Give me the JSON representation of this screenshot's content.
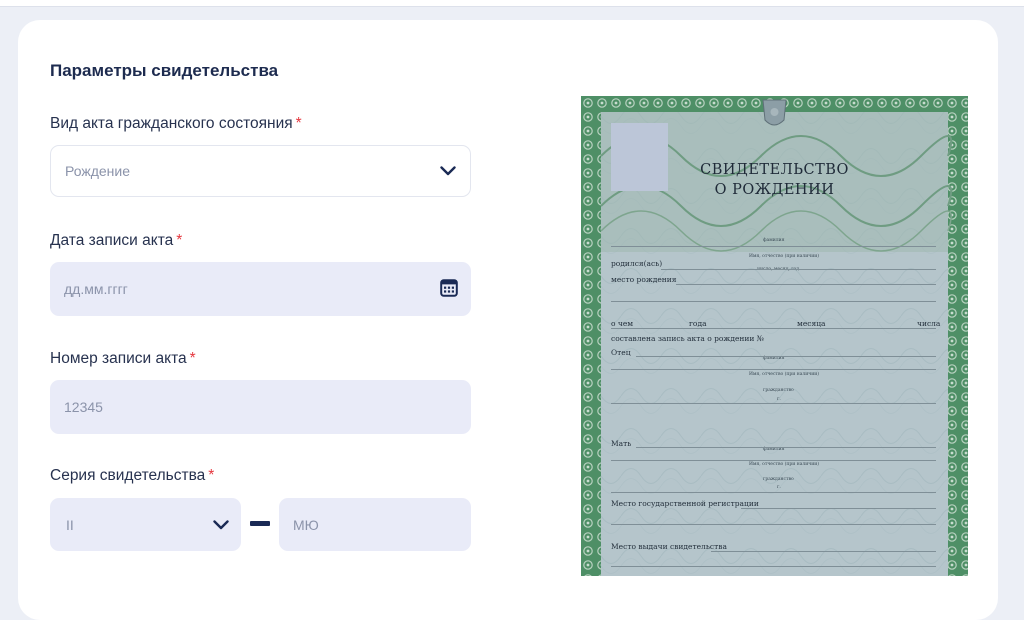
{
  "form": {
    "section_title": "Параметры свидетельства",
    "act_type": {
      "label": "Вид акта гражданского состояния",
      "required_mark": "*",
      "value": "Рождение"
    },
    "act_date": {
      "label": "Дата записи акта",
      "required_mark": "*",
      "placeholder": "дд.мм.гггг"
    },
    "act_number": {
      "label": "Номер записи акта",
      "required_mark": "*",
      "placeholder": "12345"
    },
    "cert_series": {
      "label": "Серия свидетельства",
      "required_mark": "*",
      "roman_value": "II",
      "letters_placeholder": "МЮ"
    }
  },
  "certificate": {
    "title_line1": "СВИДЕТЕЛЬСТВО",
    "title_line2": "О РОЖДЕНИИ",
    "field_born": "родился(ась)",
    "field_birthplace": "место рождения",
    "field_about": "о чем",
    "field_year": "года",
    "field_month": "месяца",
    "field_day": "числа",
    "field_record": "составлена запись акта о рождении №",
    "field_father": "Отец",
    "field_mother": "Мать",
    "field_reg_place": "Место государственной регистрации",
    "field_issue_place": "Место выдачи свидетельства",
    "hint_surname": "фамилия",
    "hint_name": "Имя, отчество (при наличии)",
    "hint_date": "число, месяц, год",
    "hint_citizenship": "гражданство",
    "hint_g": "г."
  },
  "icons": {
    "chevron": "chevron-down-icon",
    "calendar": "calendar-icon",
    "emblem": "emblem-icon"
  },
  "colors": {
    "accent": "#1a2a55",
    "required": "#e5363d",
    "field_bg": "#e9ebf8",
    "cert_frame": "#3f8a5c"
  }
}
